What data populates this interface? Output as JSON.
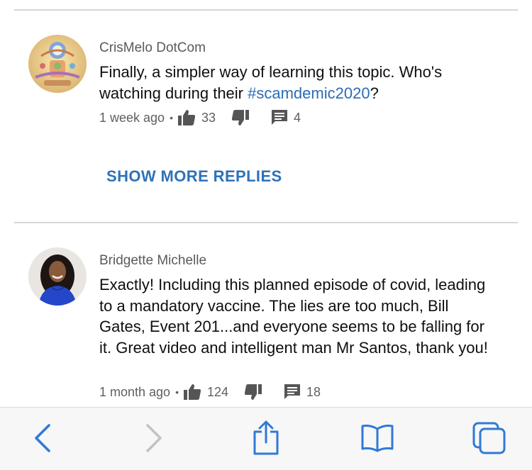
{
  "comments": [
    {
      "author": "CrisMelo DotCom",
      "text_before": "Finally, a simpler way of learning this topic. Who's watching during their ",
      "hashtag": "#scamdemic2020",
      "text_after": "?",
      "time": "1 week ago",
      "separator": "•",
      "likes": "33",
      "replies": "4"
    },
    {
      "author": "Bridgette Michelle",
      "text": "Exactly! Including this planned episode of covid, leading to a mandatory vaccine. The lies are too much, Bill Gates, Event 201...and everyone seems to be falling for it. Great video and intelligent man Mr Santos, thank you!",
      "time": "1 month ago",
      "separator": "•",
      "likes": "124",
      "replies": "18"
    }
  ],
  "show_more_replies": "SHOW MORE REPLIES",
  "colors": {
    "link": "#2e72b8",
    "hashtag": "#2b6cb3",
    "toolbar_icon": "#2f7ad6",
    "toolbar_icon_disabled": "#c2c2c7"
  },
  "toolbar": {
    "icons": [
      "back-chevron-icon",
      "forward-chevron-icon",
      "share-icon",
      "bookmarks-icon",
      "tabs-icon"
    ],
    "forward_enabled": false
  }
}
